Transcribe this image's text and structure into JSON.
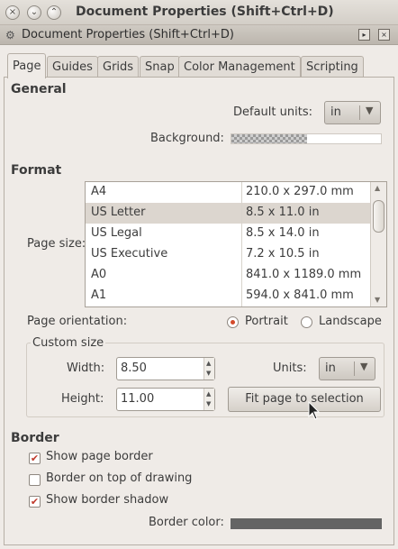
{
  "window": {
    "title": "Document Properties (Shift+Ctrl+D)",
    "buttons": {
      "close": "×",
      "minimize": "⌄",
      "maximize": "⌃"
    }
  },
  "dock": {
    "title": "Document Properties (Shift+Ctrl+D)",
    "grip_icon": "⚙",
    "btn1": "▸",
    "btn2": "×"
  },
  "tabs": [
    "Page",
    "Guides",
    "Grids",
    "Snap",
    "Color Management",
    "Scripting"
  ],
  "general": {
    "heading": "General",
    "default_units_label": "Default units:",
    "default_units_value": "in",
    "background_label": "Background:"
  },
  "format": {
    "heading": "Format",
    "page_size_label": "Page size:",
    "sizes": [
      {
        "name": "A4",
        "dims": "210.0 x 297.0 mm"
      },
      {
        "name": "US Letter",
        "dims": "8.5 x 11.0 in"
      },
      {
        "name": "US Legal",
        "dims": "8.5 x 14.0 in"
      },
      {
        "name": "US Executive",
        "dims": "7.2 x 10.5 in"
      },
      {
        "name": "A0",
        "dims": "841.0 x 1189.0 mm"
      },
      {
        "name": "A1",
        "dims": "594.0 x 841.0 mm"
      }
    ],
    "selected_index": 1,
    "orientation_label": "Page orientation:",
    "portrait": "Portrait",
    "landscape": "Landscape",
    "orientation_value": "Portrait",
    "custom_size_label": "Custom size",
    "width_label": "Width:",
    "width_value": "8.50",
    "height_label": "Height:",
    "height_value": "11.00",
    "units_label": "Units:",
    "units_value": "in",
    "fit_button": "Fit page to selection"
  },
  "border": {
    "heading": "Border",
    "show_page_border": "Show page border",
    "show_page_border_checked": true,
    "border_on_top": "Border on top of drawing",
    "border_on_top_checked": false,
    "show_border_shadow": "Show border shadow",
    "show_border_shadow_checked": true,
    "border_color_label": "Border color:",
    "border_color": "#646464"
  },
  "colors": {
    "radio_accent": "#d34a2b",
    "check_accent": "#c0392b"
  }
}
